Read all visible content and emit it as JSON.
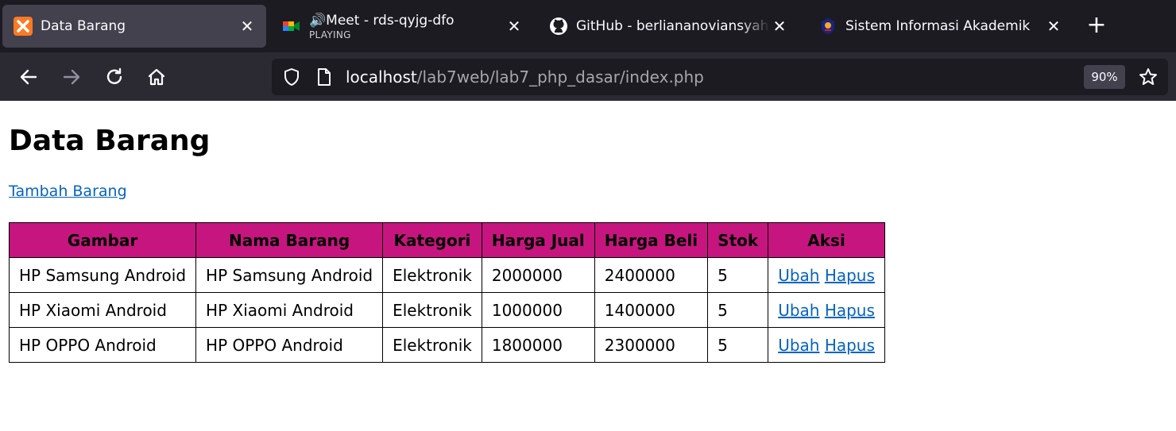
{
  "tabs": [
    {
      "title": "Data Barang",
      "subtitle": "",
      "icon": "xampp-icon",
      "active": true
    },
    {
      "title": "Meet - rds-qyjg-dfo",
      "subtitle": "PLAYING",
      "icon": "google-meet-icon",
      "active": false
    },
    {
      "title": "GitHub - berliananoviansyah/lab",
      "subtitle": "",
      "icon": "github-icon",
      "active": false
    },
    {
      "title": "Sistem Informasi Akademik",
      "subtitle": "",
      "icon": "university-logo-icon",
      "active": false
    }
  ],
  "address": {
    "host": "localhost",
    "path": "/lab7web/lab7_php_dasar/index.php"
  },
  "zoom": "90%",
  "page": {
    "title": "Data Barang",
    "add_link": "Tambah Barang",
    "headers": [
      "Gambar",
      "Nama Barang",
      "Kategori",
      "Harga Jual",
      "Harga Beli",
      "Stok",
      "Aksi"
    ],
    "rows": [
      {
        "gambar": "HP Samsung Android",
        "nama": "HP Samsung Android",
        "kategori": "Elektronik",
        "harga_jual": "2000000",
        "harga_beli": "2400000",
        "stok": "5",
        "ubah": "Ubah",
        "hapus": "Hapus"
      },
      {
        "gambar": "HP Xiaomi Android",
        "nama": "HP Xiaomi Android",
        "kategori": "Elektronik",
        "harga_jual": "1000000",
        "harga_beli": "1400000",
        "stok": "5",
        "ubah": "Ubah",
        "hapus": "Hapus"
      },
      {
        "gambar": "HP OPPO Android",
        "nama": "HP OPPO Android",
        "kategori": "Elektronik",
        "harga_jual": "1800000",
        "harga_beli": "2300000",
        "stok": "5",
        "ubah": "Ubah",
        "hapus": "Hapus"
      }
    ]
  },
  "colors": {
    "header_bg": "#c7157f",
    "link": "#0563c1",
    "tabbar_bg": "#1c1b22",
    "toolbar_bg": "#2b2a33"
  }
}
